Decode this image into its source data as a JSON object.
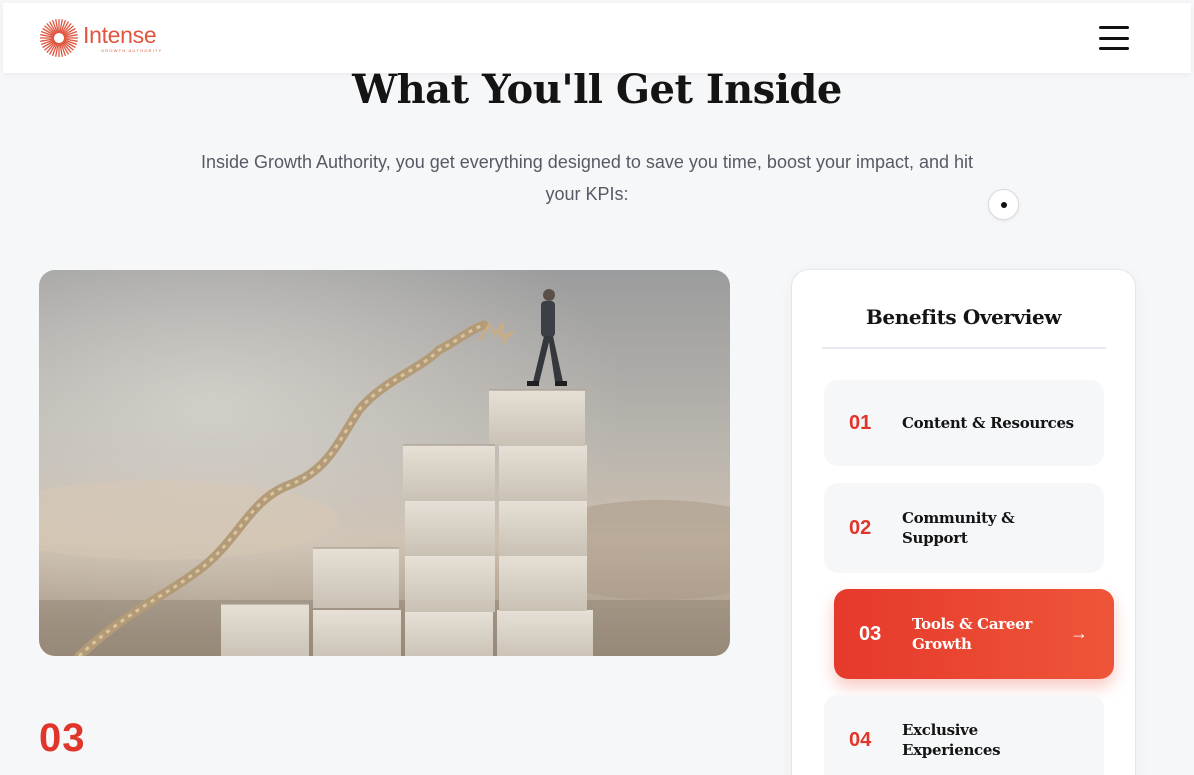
{
  "header": {
    "brand": "Intense",
    "brand_sub": "GROWTH AUTHORITY",
    "logo_icon": "starburst-logo",
    "menu_icon": "hamburger-menu-icon",
    "brand_color": "#e0553f"
  },
  "hero": {
    "title": "What You'll Get Inside",
    "intro": "Inside Growth Authority, you get everything designed to save you time, boost your impact, and hit your KPIs:"
  },
  "illustration": {
    "description_icon": "growth-staircase-image"
  },
  "active_number": "03",
  "benefits": {
    "title": "Benefits Overview",
    "accent": "#e0352a",
    "items": [
      {
        "number": "01",
        "label": "Content & Resources"
      },
      {
        "number": "02",
        "label": "Community & Support"
      },
      {
        "number": "03",
        "label": "Tools & Career Growth",
        "arrow": "→"
      },
      {
        "number": "04",
        "label": "Exclusive Experiences"
      }
    ]
  }
}
